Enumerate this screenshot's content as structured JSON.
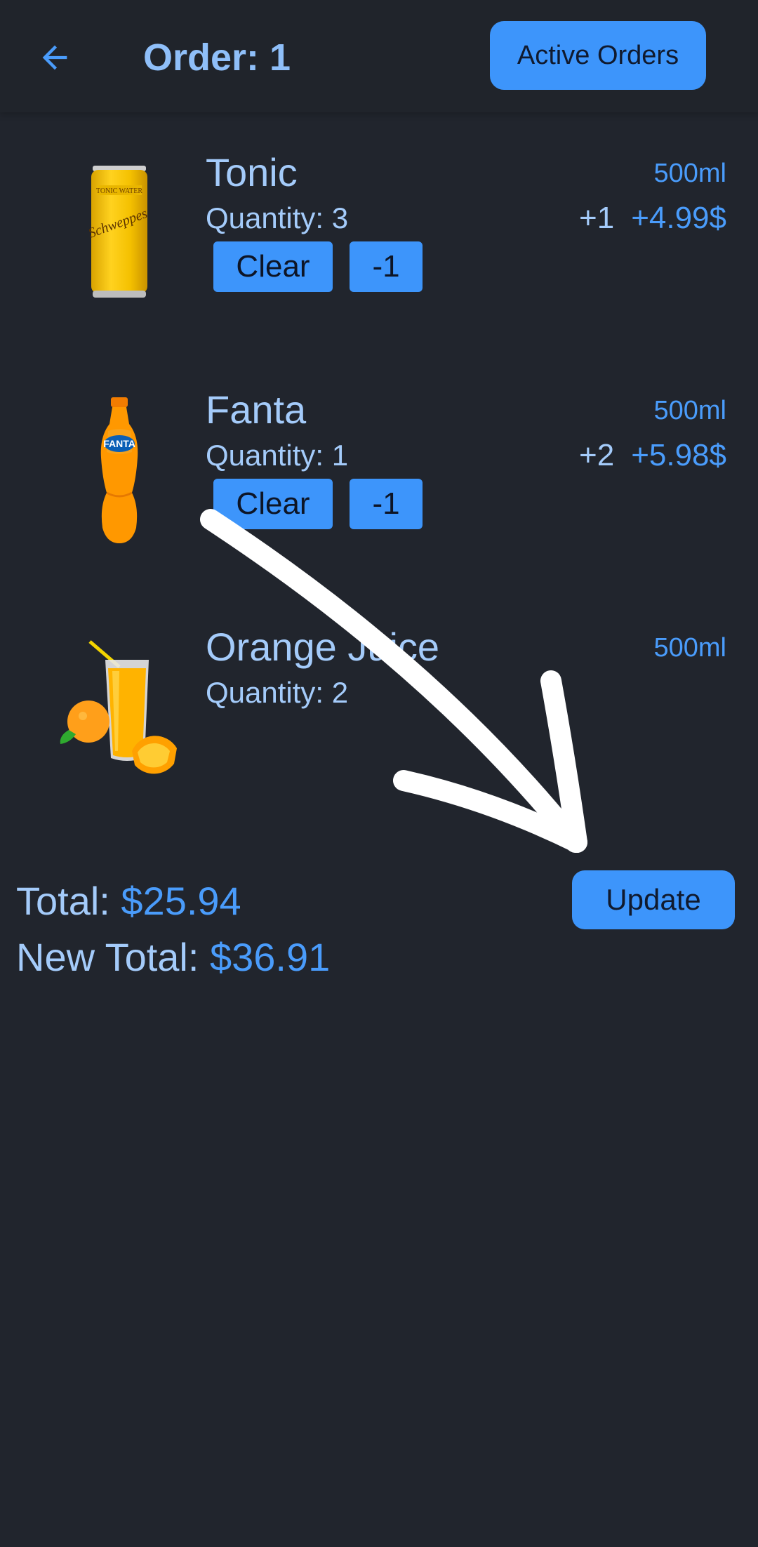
{
  "header": {
    "title": "Order: 1",
    "back_icon": "arrow-left-icon",
    "active_orders_label": "Active Orders"
  },
  "items": [
    {
      "name": "Tonic",
      "size": "500ml",
      "quantity_label": "Quantity: 3",
      "delta": "+1",
      "price_change": "+4.99$",
      "image": "tonic-can-image",
      "clear_label": "Clear",
      "minus_label": "-1"
    },
    {
      "name": "Fanta",
      "size": "500ml",
      "quantity_label": "Quantity: 1",
      "delta": "+2",
      "price_change": "+5.98$",
      "image": "fanta-bottle-image",
      "clear_label": "Clear",
      "minus_label": "-1"
    },
    {
      "name": "Orange Juice",
      "size": "500ml",
      "quantity_label": "Quantity: 2",
      "image": "orange-juice-image"
    }
  ],
  "totals": {
    "total_label": "Total: ",
    "total_value": "$25.94",
    "new_total_label": "New Total: ",
    "new_total_value": "$36.91"
  },
  "update_label": "Update",
  "colors": {
    "background": "#21252d",
    "accent": "#3d95fb",
    "text_light": "#a4cbfa",
    "text_accent": "#4a9cfb"
  }
}
